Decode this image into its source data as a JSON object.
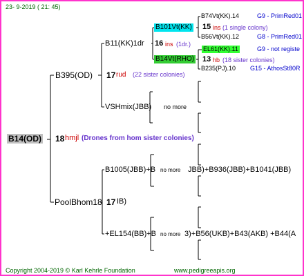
{
  "header": {
    "date": "23-  9-2019 (  21: 45)"
  },
  "root": {
    "code": "B14(OD)",
    "gen": "18",
    "breeder": "hmjl",
    "note": "(Drones from hom sister colonies)"
  },
  "queen": {
    "code": "B395(OD)",
    "gen": "17",
    "breeder": "rud",
    "note": "(22 sister colonies)"
  },
  "q_mother": {
    "code": "B11(KK)1dr",
    "gen": "16",
    "breeder": "ins",
    "note": "(1dr.)"
  },
  "q_grand_mother": {
    "code": "B101Vt(KK)",
    "gen": "15",
    "breeder": "ins",
    "note": "(1 single colony)",
    "dam": {
      "code": "B74Vt(KK).14",
      "gen_label": "G9 - PrimRed01"
    },
    "sire": {
      "code": "B56Vt(KK).12",
      "gen_label": "G8 - PrimRed01"
    }
  },
  "q_grand_sire": {
    "code": "B14Vt(RHO)",
    "gen": "13",
    "breeder": "hb",
    "note": "(18 sister colonies)",
    "dam": {
      "code": "EL61(KK).11",
      "gen_label": "G9 - not registe"
    },
    "sire": {
      "code": "B235(PJ).10",
      "gen_label": "G15 - AthosSt80R"
    }
  },
  "q_sire": {
    "code": "VSHmix(JBB)",
    "note": "no more"
  },
  "drone_line": {
    "code": "PoolBhom18",
    "gen": "17",
    "suffix": "IB)",
    "upper": {
      "part1": "B1005(JBB)+B",
      "small": "no more",
      "part2": "JBB)+B936(JBB)+B1041(JBB)"
    },
    "lower": {
      "part1": "+EL154(BB)+B",
      "small": "no more",
      "part2": "3)+B56(UKB)+B43(AKB) +B44(A"
    }
  },
  "footer": {
    "copyright": "Copyright 2004-2019 © Karl Kehrle Foundation",
    "url": "www.pedigreeapis.org"
  },
  "colors": {
    "border": "#ff33cc",
    "dark_green": "#006600",
    "cyan_box": "#00e5ee",
    "green_box": "#33cc33",
    "bright_green_box": "#33ff33",
    "root_box": "#c0c0c0",
    "breeder_red": "#cc0000",
    "note_purple": "#6633cc",
    "gen_blue": "#0000cc"
  }
}
